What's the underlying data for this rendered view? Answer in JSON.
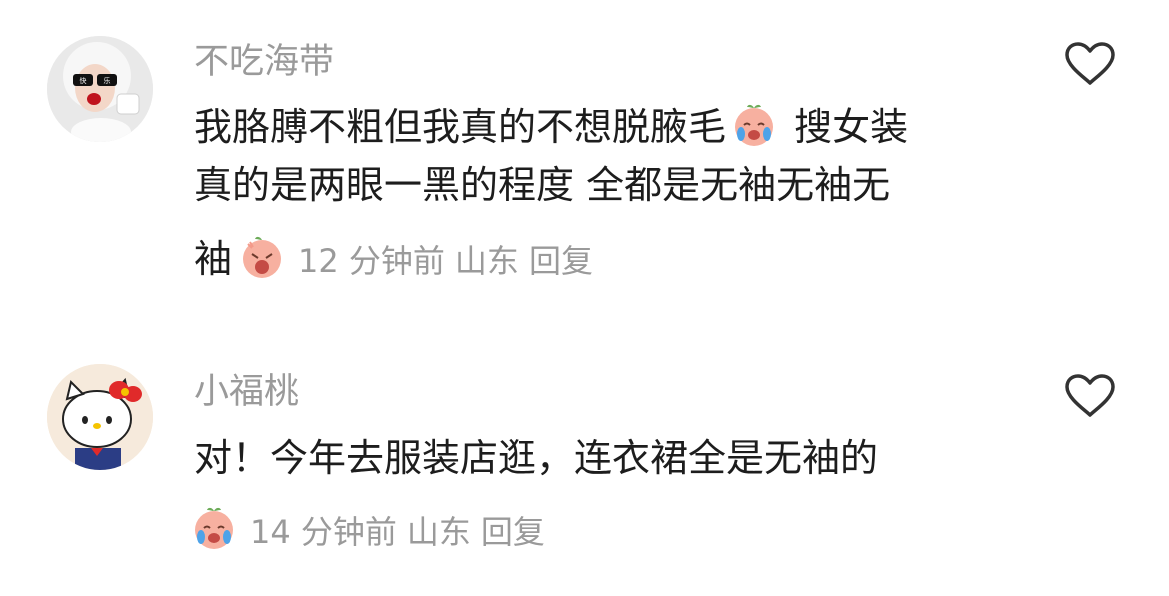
{
  "comments": [
    {
      "username": "不吃海带",
      "avatar_icon": "girl-sunglasses-avatar",
      "text_lines": [
        "我胳膊不粗但我真的不想脱腋毛",
        "搜女装",
        "真的是两眼一黑的程度 全都是无袖无袖无",
        "袖"
      ],
      "emojis": [
        "crying-peach-emoji",
        "screaming-peach-emoji"
      ],
      "time": "12 分钟前",
      "location": "山东",
      "reply_label": "回复",
      "like_icon": "heart-outline-icon"
    },
    {
      "username": "小福桃",
      "avatar_icon": "hello-kitty-avatar",
      "text_lines": [
        "对！今年去服装店逛，连衣裙全是无袖的"
      ],
      "emojis": [
        "crying-peach-emoji"
      ],
      "time": "14 分钟前",
      "location": "山东",
      "reply_label": "回复",
      "like_icon": "heart-outline-icon"
    }
  ]
}
